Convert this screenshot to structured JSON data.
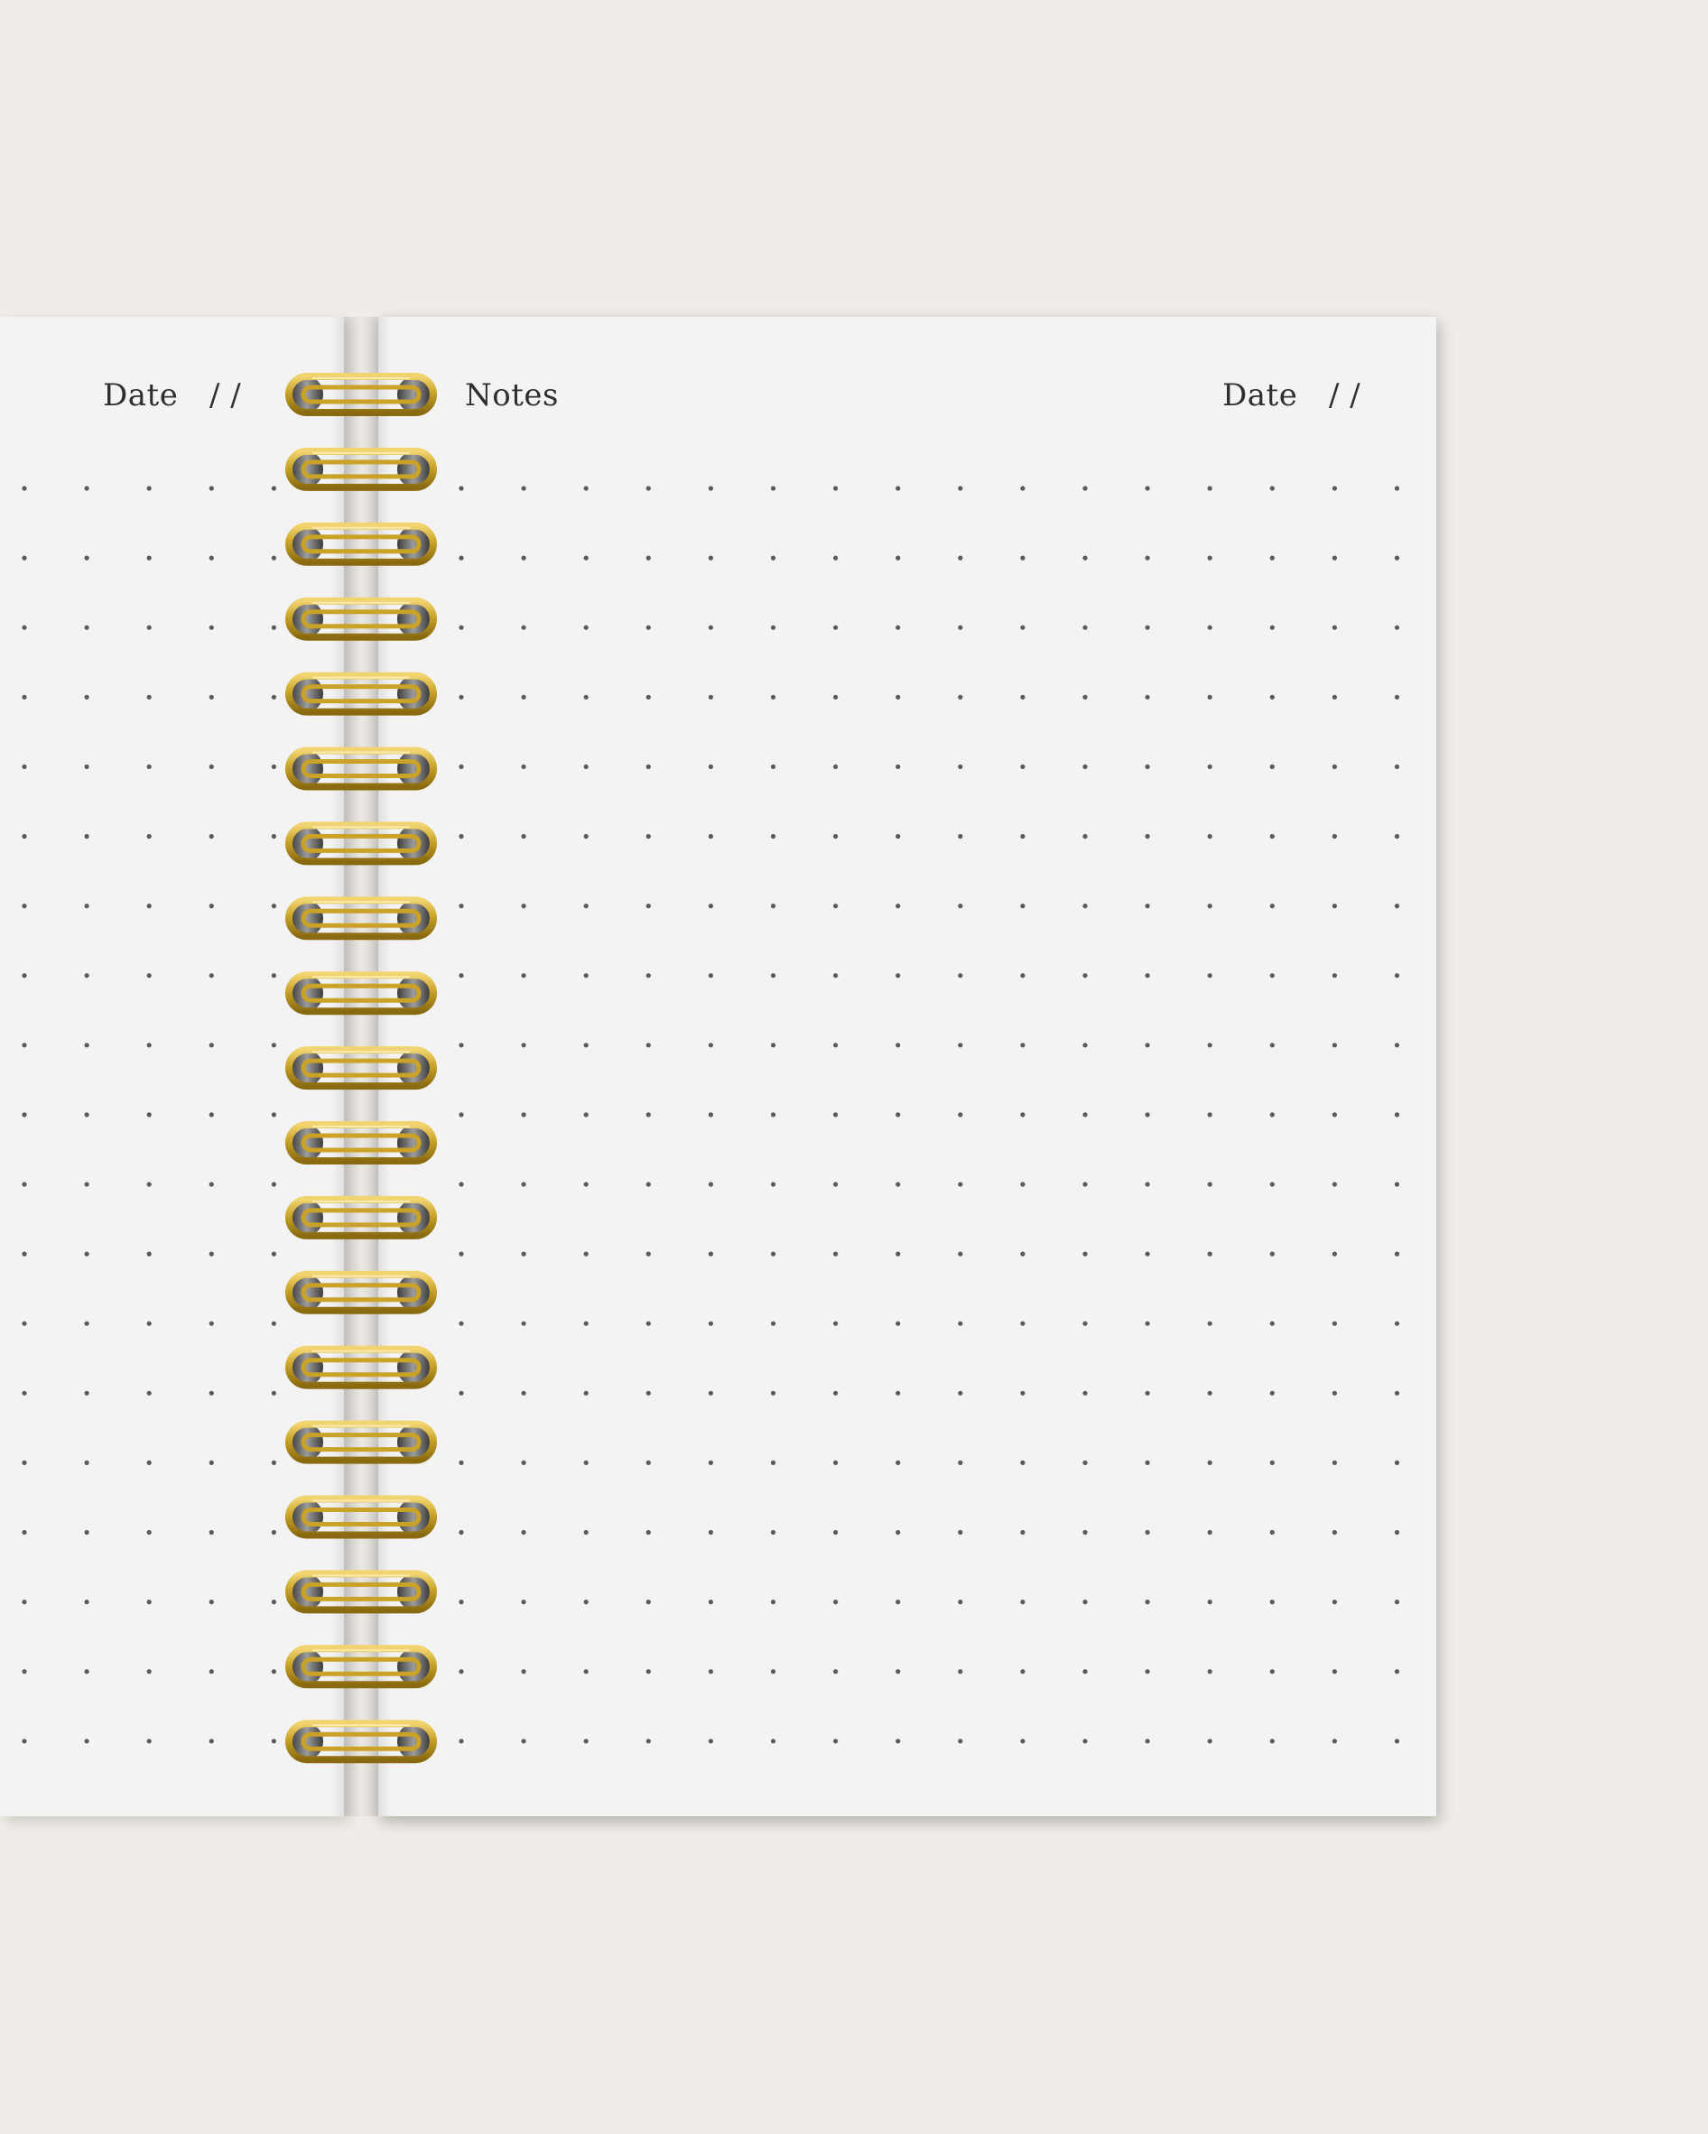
{
  "left_page": {
    "date_label": "Date",
    "date_slashes": "/ /"
  },
  "right_page": {
    "title": "Notes",
    "date_label": "Date",
    "date_slashes": "/ /"
  },
  "binding": {
    "ring_count": 19,
    "ring_color": "#c9a227"
  },
  "grid": {
    "dot_color": "#5a5a5a"
  }
}
